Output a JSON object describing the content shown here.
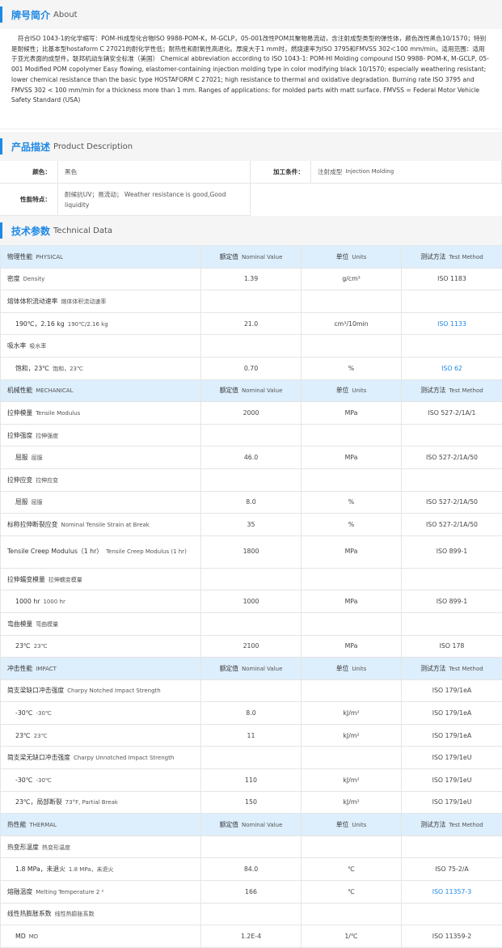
{
  "sections": {
    "about": {
      "cn": "牌号简介",
      "en": "About"
    },
    "desc": {
      "cn": "产品描述",
      "en": "Product Description"
    },
    "tech": {
      "cn": "技术参数",
      "en": "Technical Data"
    }
  },
  "about_text": "符合ISO 1043-1的化学缩写：POM-Hi成型化合物ISO 9988-POM-K，M-GCLP，05-001改性POM共聚物易流动，含注射成型类型的弹性体，颜色改性黑色10/1570；特别是耐候性；比基本型hostaform C 27021的耐化学性低；耐热性和耐氧性高退化。厚度大于1 mm时，燃烧速率为ISO 3795和FMVSS 302＜100 mm/min。适用范围：适用于亚光表面的成型件。联邦机动车辆安全标准（美国）   Chemical abbreviation according to ISO 1043-1: POM-HI Molding compound ISO 9988- POM-K, M-GCLP, 05-001 Modified POM copolymer Easy flowing, elastomer-containing injection molding type in color modifying black 10/1570; especially weathering resistant; lower chemical resistance than the basic type HOSTAFORM C 27021; high resistance to thermal and oxidative degradation. Burning rate ISO 3795 and FMVSS 302 < 100 mm/min for a thickness more than 1 mm. Ranges of applications: for molded parts with matt surface. FMVSS = Federal Motor Vehicle Safety Standard (USA)",
  "description": {
    "color_label": "颜色：",
    "color_value": "黑色",
    "process_label": "加工条件：",
    "process_value_cn": "注射成型",
    "process_value_en": "Injection Molding",
    "feature_label": "性能特点：",
    "feature_value": "耐候抗UV；易流动；  Weather resistance is good,Good liquidity"
  },
  "header_cols": {
    "nominal_cn": "额定值",
    "nominal_en": "Nominal Value",
    "units_cn": "单位",
    "units_en": "Units",
    "method_cn": "测试方法",
    "method_en": "Test Method"
  },
  "rows": [
    {
      "type": "cat",
      "cn": "物理性能",
      "en": "PHYSICAL"
    },
    {
      "type": "row",
      "cn": "密度",
      "en": "Density",
      "value": "1.39",
      "unit": "g/cm³",
      "method": "ISO 1183",
      "link": false
    },
    {
      "type": "row",
      "cn": "熔体体积流动速率",
      "en": "熔体体积流动速率",
      "value": "",
      "unit": "",
      "method": "",
      "link": false
    },
    {
      "type": "sub",
      "cn": "190℃，2.16 kg",
      "en": "190℃/2.16 kg",
      "value": "21.0",
      "unit": "cm³/10min",
      "method": "ISO 1133",
      "link": true
    },
    {
      "type": "row",
      "cn": "吸水率",
      "en": "吸水率",
      "value": "",
      "unit": "",
      "method": "",
      "link": false
    },
    {
      "type": "sub",
      "cn": "饱和，23℃",
      "en": "饱和，23℃",
      "value": "0.70",
      "unit": "%",
      "method": "ISO 62",
      "link": true
    },
    {
      "type": "cat",
      "cn": "机械性能",
      "en": "MECHANICAL"
    },
    {
      "type": "row",
      "cn": "拉伸模量",
      "en": "Tensile Modulus",
      "value": "2000",
      "unit": "MPa",
      "method": "ISO 527-2/1A/1",
      "link": false
    },
    {
      "type": "row",
      "cn": "拉伸强度",
      "en": "拉伸强度",
      "value": "",
      "unit": "",
      "method": "",
      "link": false
    },
    {
      "type": "sub",
      "cn": "屈服",
      "en": "屈服",
      "value": "46.0",
      "unit": "MPa",
      "method": "ISO 527-2/1A/50",
      "link": false
    },
    {
      "type": "row",
      "cn": "拉伸应变",
      "en": "拉伸应变",
      "value": "",
      "unit": "",
      "method": "",
      "link": false
    },
    {
      "type": "sub",
      "cn": "屈服",
      "en": "屈服",
      "value": "8.0",
      "unit": "%",
      "method": "ISO 527-2/1A/50",
      "link": false
    },
    {
      "type": "row",
      "cn": "标称拉伸断裂应变",
      "en": "Nominal Tensile Strain at Break",
      "value": "35",
      "unit": "%",
      "method": "ISO 527-2/1A/50",
      "link": false
    },
    {
      "type": "tall",
      "cn": "Tensile Creep Modulus（1 hr）",
      "en": "Tensile Creep Modulus (1 hr)",
      "value": "1800",
      "unit": "MPa",
      "method": "ISO 899-1",
      "link": false
    },
    {
      "type": "row",
      "cn": "拉伸蠕变模量",
      "en": "拉伸蠕变模量",
      "value": "",
      "unit": "",
      "method": "",
      "link": false
    },
    {
      "type": "sub",
      "cn": "1000 hr",
      "en": "1000 hr",
      "value": "1000",
      "unit": "MPa",
      "method": "ISO 899-1",
      "link": false
    },
    {
      "type": "row",
      "cn": "弯曲模量",
      "en": "弯曲模量",
      "value": "",
      "unit": "",
      "method": "",
      "link": false
    },
    {
      "type": "sub",
      "cn": "23℃",
      "en": "23℃",
      "value": "2100",
      "unit": "MPa",
      "method": "ISO 178",
      "link": false
    },
    {
      "type": "cat",
      "cn": "冲击性能",
      "en": "IMPACT"
    },
    {
      "type": "row",
      "cn": "简支梁缺口冲击强度",
      "en": "Charpy Notched Impact Strength",
      "value": "",
      "unit": "",
      "method": "ISO 179/1eA",
      "link": false
    },
    {
      "type": "sub",
      "cn": "-30℃",
      "en": "-30℃",
      "value": "8.0",
      "unit": "kJ/m²",
      "method": "ISO 179/1eA",
      "link": false
    },
    {
      "type": "sub",
      "cn": "23℃",
      "en": "23℃",
      "value": "11",
      "unit": "kJ/m²",
      "method": "ISO 179/1eA",
      "link": false
    },
    {
      "type": "row",
      "cn": "简支梁无缺口冲击强度",
      "en": "Charpy Unnotched Impact Strength",
      "value": "",
      "unit": "",
      "method": "ISO 179/1eU",
      "link": false
    },
    {
      "type": "sub",
      "cn": "-30℃",
      "en": "-30℃",
      "value": "110",
      "unit": "kJ/m²",
      "method": "ISO 179/1eU",
      "link": false
    },
    {
      "type": "sub",
      "cn": "23℃，局部断裂",
      "en": "73°F, Partial Break",
      "value": "150",
      "unit": "kJ/m²",
      "method": "ISO 179/1eU",
      "link": false
    },
    {
      "type": "cat",
      "cn": "热性能",
      "en": "THERMAL"
    },
    {
      "type": "row",
      "cn": "热变形温度",
      "en": "热变形温度",
      "value": "",
      "unit": "",
      "method": "",
      "link": false
    },
    {
      "type": "sub",
      "cn": "1.8 MPa，未退火",
      "en": "1.8 MPa，未退火",
      "value": "84.0",
      "unit": "℃",
      "method": "ISO 75-2/A",
      "link": false
    },
    {
      "type": "row",
      "cn": "熔融温度",
      "en": "Melting Temperature  2 ²",
      "value": "166",
      "unit": "℃",
      "method": "ISO 11357-3",
      "link": true
    },
    {
      "type": "row",
      "cn": "线性热膨胀系数",
      "en": "线性热膨胀系数",
      "value": "",
      "unit": "",
      "method": "",
      "link": false
    },
    {
      "type": "sub",
      "cn": "MD",
      "en": "MD",
      "value": "1.2E-4",
      "unit": "1/℃",
      "method": "ISO 11359-2",
      "link": false
    }
  ]
}
